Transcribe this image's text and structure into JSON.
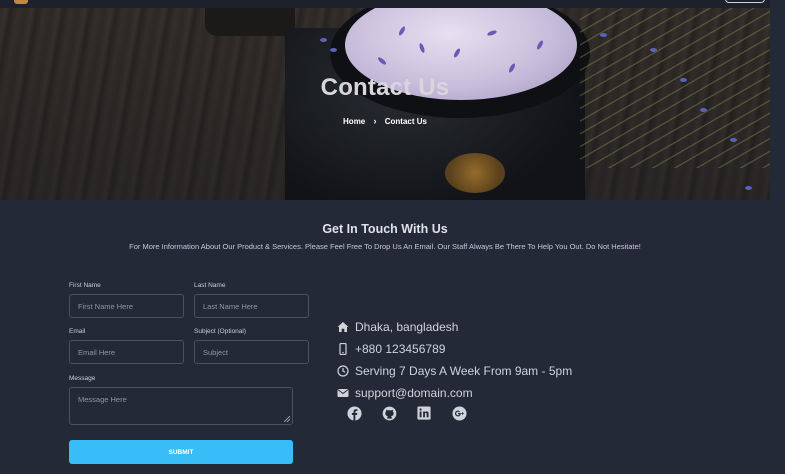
{
  "hero": {
    "title": "Contact Us",
    "breadcrumb": {
      "home": "Home",
      "separator": "›",
      "current": "Contact Us"
    }
  },
  "intro": {
    "title": "Get In Touch With Us",
    "text": "For More Information About Our Product & Services. Please Feel Free To Drop Us An Email. Our Staff Always Be There To Help You Out. Do Not Hesitate!"
  },
  "form": {
    "first_name": {
      "label": "First Name",
      "placeholder": "First Name Here"
    },
    "last_name": {
      "label": "Last Name",
      "placeholder": "Last Name Here"
    },
    "email": {
      "label": "Email",
      "placeholder": "Email Here"
    },
    "subject": {
      "label": "Subject (Optional)",
      "placeholder": "Subject"
    },
    "message": {
      "label": "Message",
      "placeholder": "Message Here"
    },
    "submit_label": "SUBMIT"
  },
  "contact": {
    "address": "Dhaka, bangladesh",
    "phone": "+880 123456789",
    "hours": "Serving 7 Days A Week From 9am - 5pm",
    "email": "support@domain.com"
  },
  "socials": [
    {
      "icon": "facebook-icon"
    },
    {
      "icon": "github-icon"
    },
    {
      "icon": "linkedin-icon"
    },
    {
      "icon": "google-plus-icon"
    }
  ],
  "colors": {
    "background": "#242937",
    "accent": "#38bdf8",
    "text": "#cfd3da"
  }
}
